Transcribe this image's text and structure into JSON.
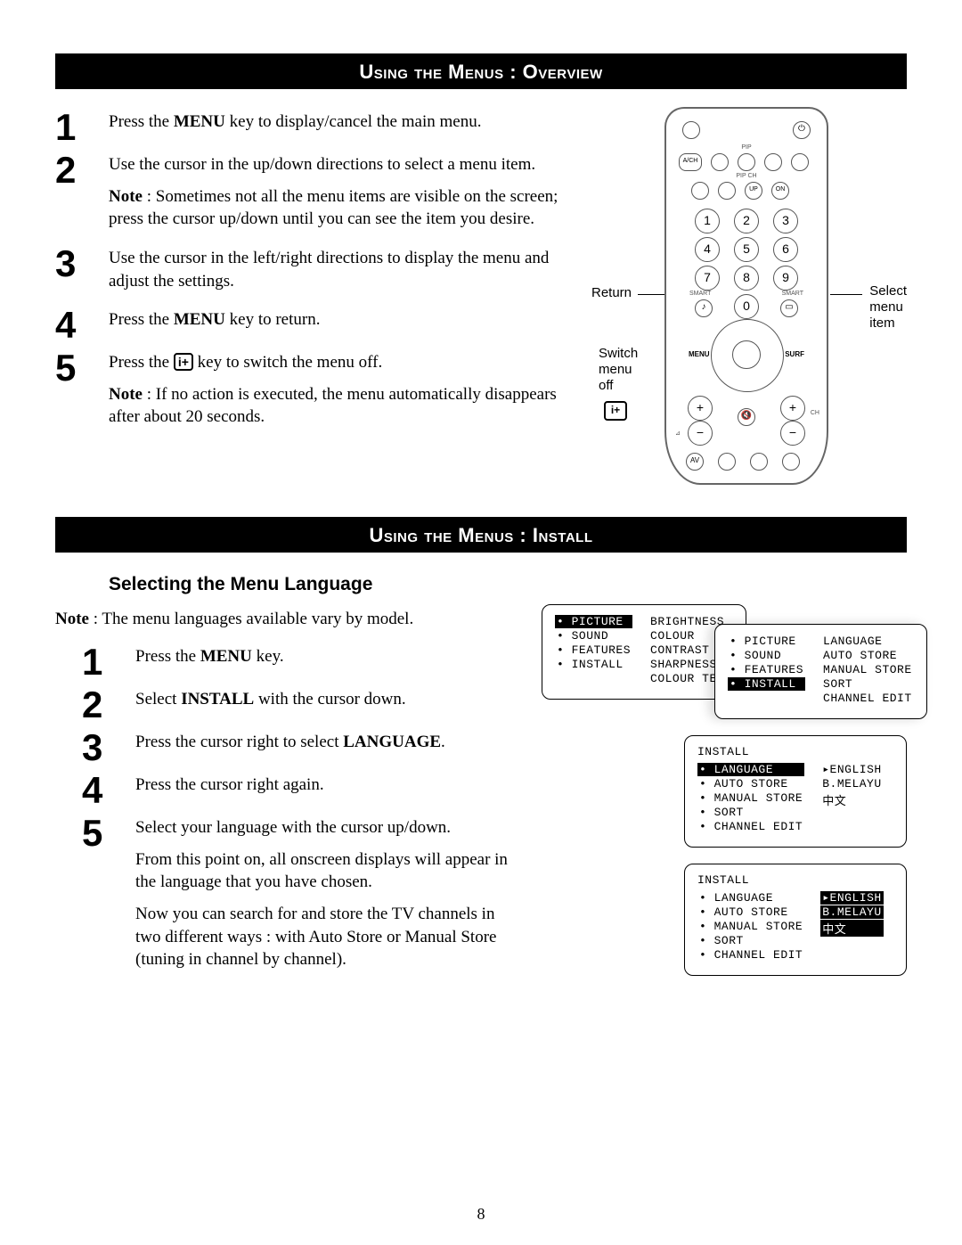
{
  "page_number": "8",
  "headings": {
    "overview": "Using the Menus : Overview",
    "install": "Using the Menus : Install",
    "select_lang": "Selecting the Menu Language"
  },
  "overview_steps": {
    "s1": {
      "num": "1",
      "body": "Press the <b>MENU</b> key to display/cancel the main menu."
    },
    "s2": {
      "num": "2",
      "body": "Use the cursor in the up/down directions to select a menu item.",
      "note": "<b>Note</b> : Sometimes not all the menu items are visible on the screen; press the cursor up/down until you can see the item you desire."
    },
    "s3": {
      "num": "3",
      "body": "Use the cursor in the left/right directions to display the menu and adjust the settings."
    },
    "s4": {
      "num": "4",
      "body": "Press the <b>MENU</b> key to return."
    },
    "s5": {
      "num": "5",
      "body": "Press the <span class='i-plus'>i+</span> key to switch the menu off.",
      "note": "<b>Note</b> : If no action is executed, the menu automatically disappears after about 20 seconds."
    }
  },
  "install_intro_note": "<b>Note</b> : The menu languages available vary by model.",
  "install_steps": {
    "s1": {
      "num": "1",
      "body": "Press the <b>MENU</b> key."
    },
    "s2": {
      "num": "2",
      "body": "Select <b>INSTALL</b> with the cursor down."
    },
    "s3": {
      "num": "3",
      "body": "Press the cursor right to select <b>LANGUAGE</b>."
    },
    "s4": {
      "num": "4",
      "body": "Press the cursor right again."
    },
    "s5": {
      "num": "5",
      "body": "Select your language with the cursor up/down."
    }
  },
  "install_trailing": [
    "From this point on, all onscreen displays will appear in the language that you have chosen.",
    "Now you can search for and store the TV channels in two different ways : with Auto Store or Manual Store (tuning in channel by channel)."
  ],
  "remote": {
    "labels": {
      "return": "Return",
      "switch_off": "Switch\nmenu\noff",
      "select_item": "Select\nmenu\nitem",
      "pip": "PIP",
      "pipch": "PIP CH",
      "smart_l": "SMART",
      "smart_r": "SMART",
      "ach": "A/CH",
      "up": "UP",
      "on": "ON",
      "ch": "CH",
      "menu": "MENU",
      "surf": "SURF",
      "av": "AV",
      "iplus": "i+"
    },
    "digits": [
      "1",
      "2",
      "3",
      "4",
      "5",
      "6",
      "7",
      "8",
      "9",
      "0"
    ]
  },
  "osd": {
    "menu1": {
      "left": [
        "PICTURE",
        "SOUND",
        "FEATURES",
        "INSTALL"
      ],
      "left_selected": 0,
      "right": [
        "BRIGHTNESS",
        "COLOUR",
        "CONTRAST",
        "SHARPNESS",
        "COLOUR TEMP"
      ]
    },
    "menu2": {
      "left": [
        "PICTURE",
        "SOUND",
        "FEATURES",
        "INSTALL"
      ],
      "left_selected": 3,
      "right": [
        "LANGUAGE",
        "AUTO STORE",
        "MANUAL STORE",
        "SORT",
        "CHANNEL EDIT"
      ]
    },
    "menu3": {
      "title": "INSTALL",
      "left": [
        "LANGUAGE",
        "AUTO STORE",
        "MANUAL STORE",
        "SORT",
        "CHANNEL EDIT",
        ""
      ],
      "left_selected": 0,
      "right": [
        "ENGLISH",
        "B.MELAYU",
        "中文"
      ],
      "right_arrow_index": 0
    },
    "menu4": {
      "title": "INSTALL",
      "left": [
        "LANGUAGE",
        "AUTO STORE",
        "MANUAL STORE",
        "SORT",
        "CHANNEL EDIT",
        ""
      ],
      "right": [
        "ENGLISH",
        "B.MELAYU",
        "中文"
      ],
      "right_highlight_all": true,
      "right_arrow_index": 0
    }
  }
}
